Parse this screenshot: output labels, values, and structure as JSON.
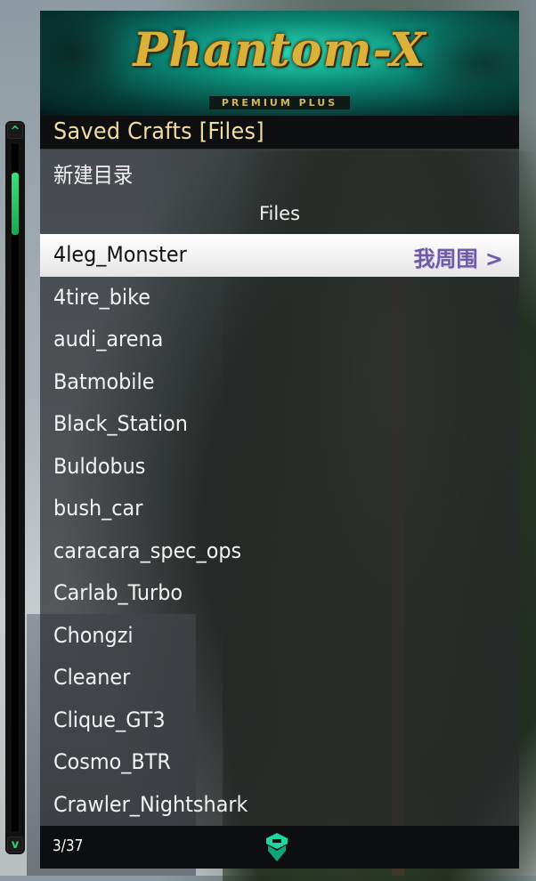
{
  "menu": {
    "banner": {
      "logo": "Phantom-X",
      "subtitle": "PREMIUM PLUS"
    },
    "title": "Saved Crafts [Files]",
    "items": [
      {
        "label": "新建目录"
      },
      {
        "label": "Files",
        "header": true
      },
      {
        "label": "4leg_Monster",
        "suffix": "我周围 >",
        "selected": true
      },
      {
        "label": "4tire_bike"
      },
      {
        "label": "audi_arena"
      },
      {
        "label": "Batmobile"
      },
      {
        "label": "Black_Station"
      },
      {
        "label": "Buldobus"
      },
      {
        "label": "bush_car"
      },
      {
        "label": "caracara_spec_ops"
      },
      {
        "label": "Carlab_Turbo"
      },
      {
        "label": "Chongzi"
      },
      {
        "label": "Cleaner"
      },
      {
        "label": "Clique_GT3"
      },
      {
        "label": "Cosmo_BTR"
      },
      {
        "label": "Crawler_Nightshark"
      }
    ],
    "footer": {
      "count": "3/37",
      "emblem_icon": "phantom-emblem-icon"
    }
  },
  "scrollbar": {
    "up_icon": "chevron-up-icon",
    "down_icon": "chevron-down-icon",
    "accent_color": "#2fd36b"
  }
}
